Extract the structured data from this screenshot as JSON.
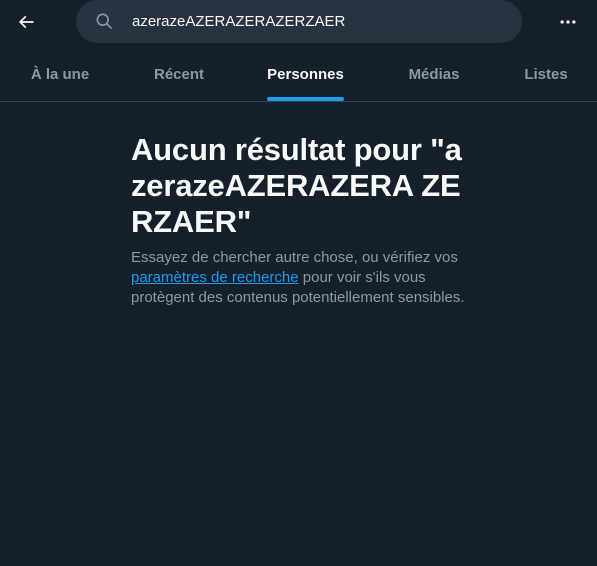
{
  "header": {
    "back_icon": "arrow-left-icon",
    "search": {
      "icon": "search-icon",
      "value": "azerazeAZERAZERAZERZAER"
    },
    "more_icon": "more-horizontal-icon"
  },
  "tabs": [
    {
      "label": "À la une"
    },
    {
      "label": "Récent"
    },
    {
      "label": "Personnes"
    },
    {
      "label": "Médias"
    },
    {
      "label": "Listes"
    }
  ],
  "active_tab": "Personnes",
  "empty_state": {
    "title": "Aucun résultat pour \"azerazeAZERAZERA ZERZAER\"",
    "desc_before": "Essayez de chercher autre chose, ou vérifiez vos ",
    "link": "paramètres de recherche",
    "desc_after": " pour voir s'ils vous protègent des contenus potentiellement sensibles."
  },
  "colors": {
    "background": "#15202b",
    "search_bg": "#273340",
    "text_primary": "#f7f9f9",
    "text_secondary": "#8b98a5",
    "accent": "#1d9bf0",
    "border": "#38444d"
  }
}
